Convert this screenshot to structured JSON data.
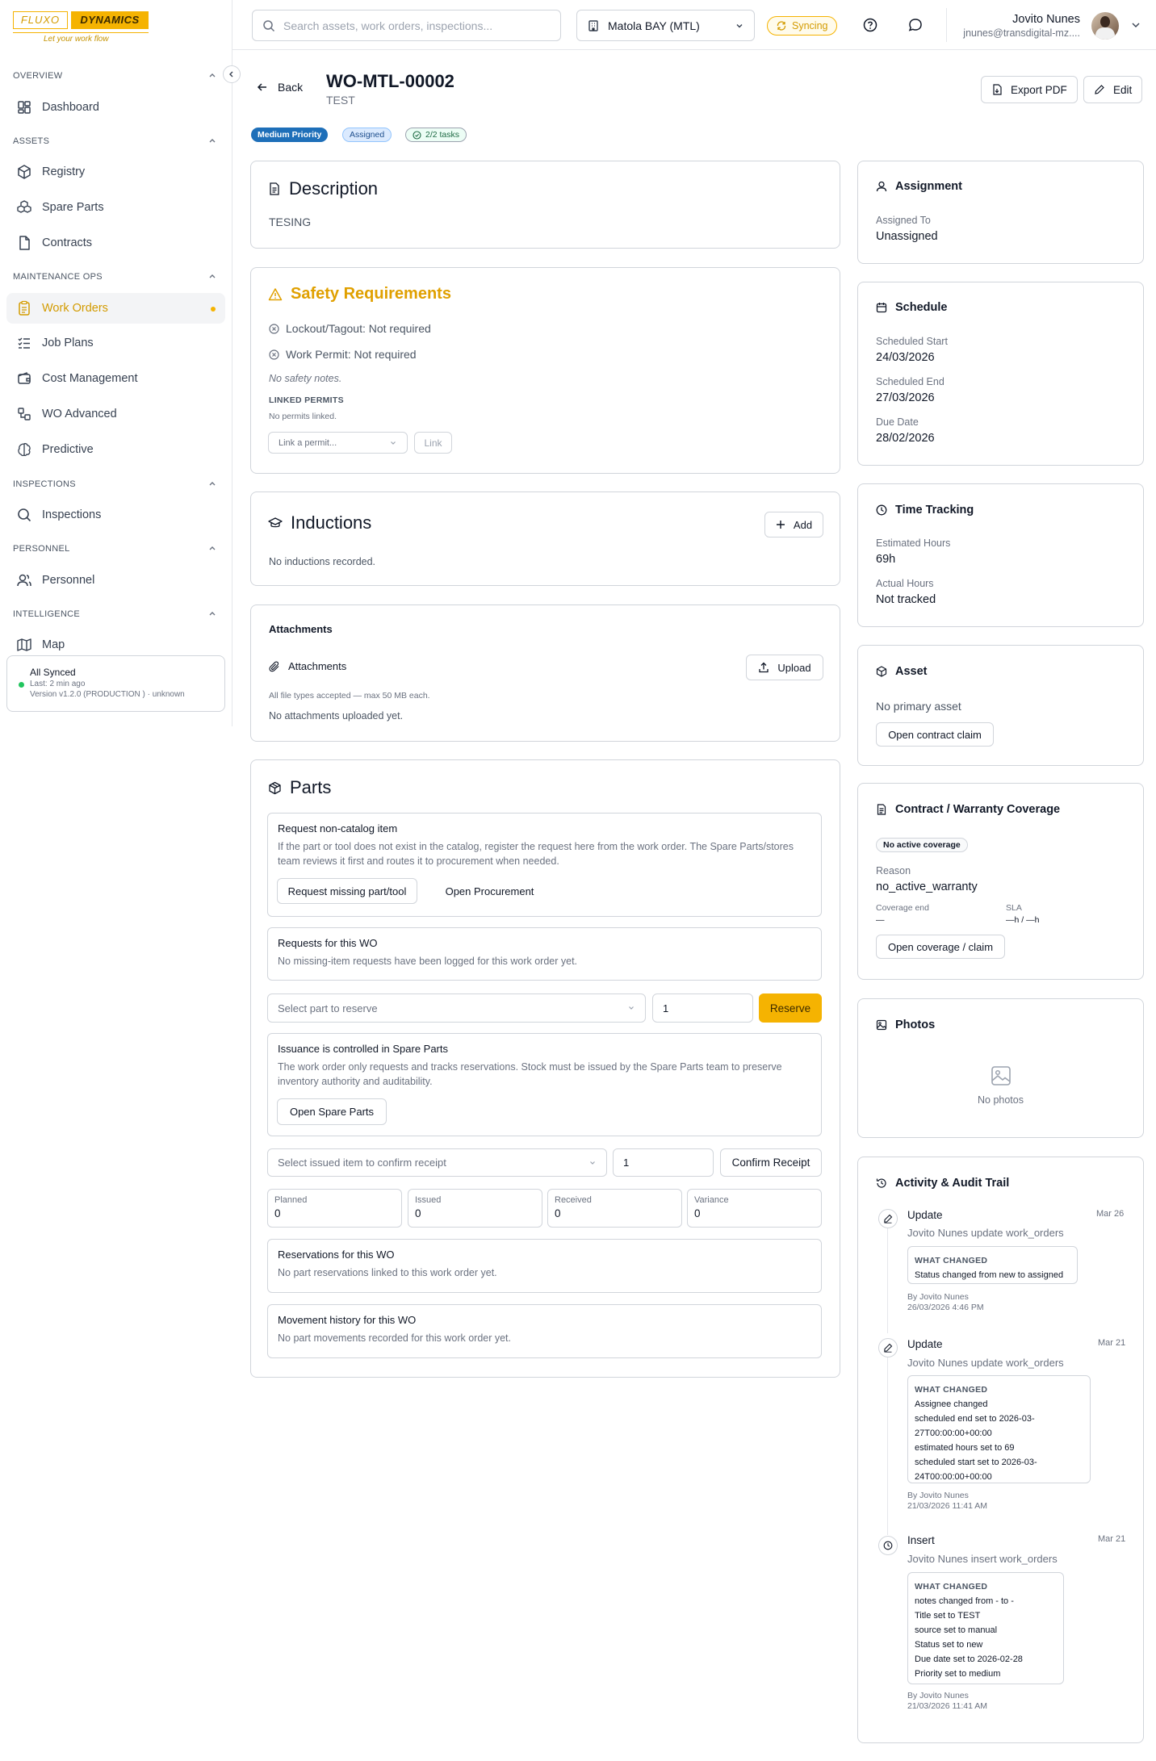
{
  "brand": {
    "word1": "FLUXO",
    "word2": "DYNAMICS",
    "tagline": "Let your work flow"
  },
  "sidebar": {
    "sections": [
      {
        "label": "OVERVIEW"
      },
      {
        "label": "ASSETS"
      },
      {
        "label": "MAINTENANCE OPS"
      },
      {
        "label": "INSPECTIONS"
      },
      {
        "label": "PERSONNEL"
      },
      {
        "label": "INTELLIGENCE"
      }
    ],
    "items": [
      {
        "label": "Dashboard",
        "icon": "dashboard-icon"
      },
      {
        "label": "Registry",
        "icon": "box-icon"
      },
      {
        "label": "Spare Parts",
        "icon": "boxes-icon"
      },
      {
        "label": "Contracts",
        "icon": "file-icon"
      },
      {
        "label": "Work Orders",
        "icon": "clipboard-icon",
        "active": true
      },
      {
        "label": "Job Plans",
        "icon": "list-check-icon"
      },
      {
        "label": "Cost Management",
        "icon": "wallet-icon"
      },
      {
        "label": "WO Advanced",
        "icon": "workflow-icon"
      },
      {
        "label": "Predictive",
        "icon": "brain-icon"
      },
      {
        "label": "Inspections",
        "icon": "search-icon"
      },
      {
        "label": "Personnel",
        "icon": "users-icon"
      },
      {
        "label": "Map",
        "icon": "map-icon"
      }
    ],
    "sync": {
      "title": "All Synced",
      "last": "Last: 2 min ago",
      "version": "Version v1.2.0 (PRODUCTION ) · unknown"
    }
  },
  "topbar": {
    "search_placeholder": "Search assets, work orders, inspections...",
    "site": "Matola BAY (MTL)",
    "sync_status": "Syncing",
    "user_name": "Jovito Nunes",
    "user_email": "jnunes@transdigital-mz...."
  },
  "header": {
    "back_label": "Back",
    "title": "WO-MTL-00002",
    "subtitle": "TEST",
    "export_label": "Export PDF",
    "edit_label": "Edit",
    "priority": "Medium Priority",
    "status": "Assigned",
    "tasks": "2/2 tasks"
  },
  "description": {
    "title": "Description",
    "text": "TESING"
  },
  "safety": {
    "title": "Safety Requirements",
    "lockout": "Lockout/Tagout: Not required",
    "permit": "Work Permit: Not required",
    "notes": "No safety notes.",
    "linked_label": "LINKED PERMITS",
    "no_permits": "No permits linked.",
    "select_placeholder": "Link a permit...",
    "link_label": "Link"
  },
  "inductions": {
    "title": "Inductions",
    "add_label": "Add",
    "empty": "No inductions recorded."
  },
  "attachments": {
    "title": "Attachments",
    "sub_title": "Attachments",
    "upload_label": "Upload",
    "hint": "All file types accepted — max 50 MB each.",
    "empty": "No attachments uploaded yet."
  },
  "parts": {
    "title": "Parts",
    "noncatalog_title": "Request non-catalog item",
    "noncatalog_desc": "If the part or tool does not exist in the catalog, register the request here from the work order. The Spare Parts/stores team reviews it first and routes it to procurement when needed.",
    "request_missing_label": "Request missing part/tool",
    "open_procurement_label": "Open Procurement",
    "requests_title": "Requests for this WO",
    "requests_empty": "No missing-item requests have been logged for this work order yet.",
    "reserve_placeholder": "Select part to reserve",
    "reserve_qty": "1",
    "reserve_label": "Reserve",
    "issuance_title": "Issuance is controlled in Spare Parts",
    "issuance_desc": "The work order only requests and tracks reservations. Stock must be issued by the Spare Parts team to preserve inventory authority and auditability.",
    "open_spare_label": "Open Spare Parts",
    "receipt_placeholder": "Select issued item to confirm receipt",
    "receipt_qty": "1",
    "confirm_label": "Confirm Receipt",
    "metrics": [
      {
        "label": "Planned",
        "value": "0"
      },
      {
        "label": "Issued",
        "value": "0"
      },
      {
        "label": "Received",
        "value": "0"
      },
      {
        "label": "Variance",
        "value": "0"
      }
    ],
    "reservations_title": "Reservations for this WO",
    "reservations_empty": "No part reservations linked to this work order yet.",
    "movement_title": "Movement history for this WO",
    "movement_empty": "No part movements recorded for this work order yet."
  },
  "assignment": {
    "title": "Assignment",
    "label": "Assigned To",
    "value": "Unassigned"
  },
  "schedule": {
    "title": "Schedule",
    "start_label": "Scheduled Start",
    "start": "24/03/2026",
    "end_label": "Scheduled End",
    "end": "27/03/2026",
    "due_label": "Due Date",
    "due": "28/02/2026"
  },
  "time_tracking": {
    "title": "Time Tracking",
    "est_label": "Estimated Hours",
    "est": "69h",
    "act_label": "Actual Hours",
    "act": "Not tracked"
  },
  "asset": {
    "title": "Asset",
    "empty": "No primary asset",
    "button": "Open contract claim"
  },
  "warranty": {
    "title": "Contract / Warranty Coverage",
    "badge": "No active coverage",
    "reason_label": "Reason",
    "reason": "no_active_warranty",
    "coverage_end_label": "Coverage end",
    "coverage_end": "—",
    "sla_label": "SLA",
    "sla": "—h / —h",
    "button": "Open coverage / claim"
  },
  "photos": {
    "title": "Photos",
    "empty": "No photos"
  },
  "activity": {
    "title": "Activity & Audit Trail",
    "changed_label": "WHAT CHANGED",
    "entries": [
      {
        "type": "Update",
        "date": "Mar 26",
        "desc": "Jovito Nunes update work_orders",
        "changes": [
          "Status changed from new to assigned"
        ],
        "by": "By Jovito Nunes",
        "when": "26/03/2026 4:46 PM"
      },
      {
        "type": "Update",
        "date": "Mar 21",
        "desc": "Jovito Nunes update work_orders",
        "changes": [
          "Assignee changed",
          "scheduled end set to 2026-03-",
          "27T00:00:00+00:00",
          "estimated hours set to 69",
          "scheduled start set to 2026-03-",
          "24T00:00:00+00:00"
        ],
        "by": "By Jovito Nunes",
        "when": "21/03/2026 11:41 AM"
      },
      {
        "type": "Insert",
        "date": "Mar 21",
        "desc": "Jovito Nunes insert work_orders",
        "changes": [
          "notes changed from - to -",
          "Title set to TEST",
          "source set to manual",
          "Status set to new",
          "Due date set to 2026-02-28",
          "Priority set to medium"
        ],
        "by": "By Jovito Nunes",
        "when": "21/03/2026 11:41 AM"
      }
    ]
  },
  "colors": {
    "accent": "#f5b301",
    "priority": "#1e6fb9",
    "safety": "#e0a000"
  }
}
